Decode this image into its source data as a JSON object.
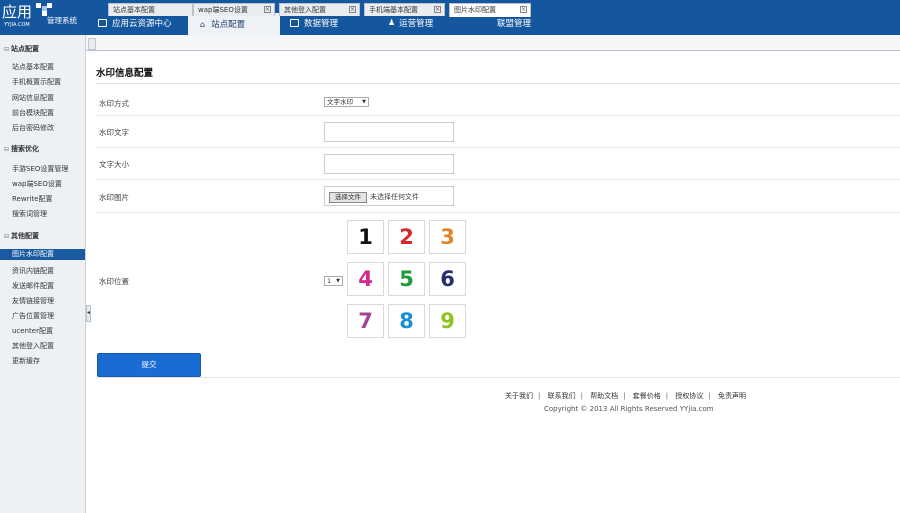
{
  "brand": {
    "logo_cn": "应用",
    "logo_en": "YYJIA.COM",
    "system_name": "管理系统"
  },
  "top_nav": [
    {
      "label": "应用云资源中心"
    },
    {
      "label": "站点配置"
    },
    {
      "label": "数据管理"
    },
    {
      "label": "运营管理"
    },
    {
      "label": "联盟管理"
    }
  ],
  "sidebar": {
    "groups": [
      {
        "label": "站点配置",
        "items": [
          "站点基本配置",
          "手机概置示配置",
          "网站信息配置",
          "前台模块配置",
          "后台密码修改"
        ]
      },
      {
        "label": "搜索优化",
        "items": [
          "手游SEO设置管理",
          "wap端SEO设置",
          "Rewrite配置",
          "搜索词管理"
        ]
      },
      {
        "label": "其他配置",
        "items": [
          "图片水印配置",
          "资讯内链配置",
          "发送邮件配置",
          "友情链接管理",
          "广告位置管理",
          "ucenter配置",
          "其他登入配置",
          "更新缓存"
        ]
      }
    ],
    "active_item": "图片水印配置"
  },
  "tabs": [
    {
      "label": "站点基本配置"
    },
    {
      "label": "wap端SEO设置"
    },
    {
      "label": "其他登入配置"
    },
    {
      "label": "手机端基本配置"
    },
    {
      "label": "图片水印配置"
    }
  ],
  "form": {
    "title": "水印信息配置",
    "mode_label": "水印方式",
    "mode_value": "文字水印",
    "text_label": "水印文字",
    "text_value": "",
    "size_label": "文字大小",
    "size_value": "",
    "image_label": "水印图片",
    "file_button": "选择文件",
    "file_status": "未选择任何文件",
    "position_label": "水印位置",
    "position_value": "1",
    "submit_label": "提交"
  },
  "position_grid": [
    {
      "n": "1",
      "color": "#111111"
    },
    {
      "n": "2",
      "color": "#d62a2a"
    },
    {
      "n": "3",
      "color": "#e0872a"
    },
    {
      "n": "4",
      "color": "#d42a8c"
    },
    {
      "n": "5",
      "color": "#1f9a3a"
    },
    {
      "n": "6",
      "color": "#2a2a6e"
    },
    {
      "n": "7",
      "color": "#a0459a"
    },
    {
      "n": "8",
      "color": "#1a8fd6"
    },
    {
      "n": "9",
      "color": "#8dc21f"
    }
  ],
  "footer": {
    "links": [
      "关于我们",
      "联系我们",
      "帮助文档",
      "套餐价格",
      "授权协议",
      "免责声明"
    ],
    "copyright": "Copyright © 2013 All Rights Reserved YYjia.com"
  },
  "colors": {
    "header_bg": "#15579e",
    "sidebar_active": "#1a5aa3",
    "submit_bg": "#1a6cd2"
  }
}
